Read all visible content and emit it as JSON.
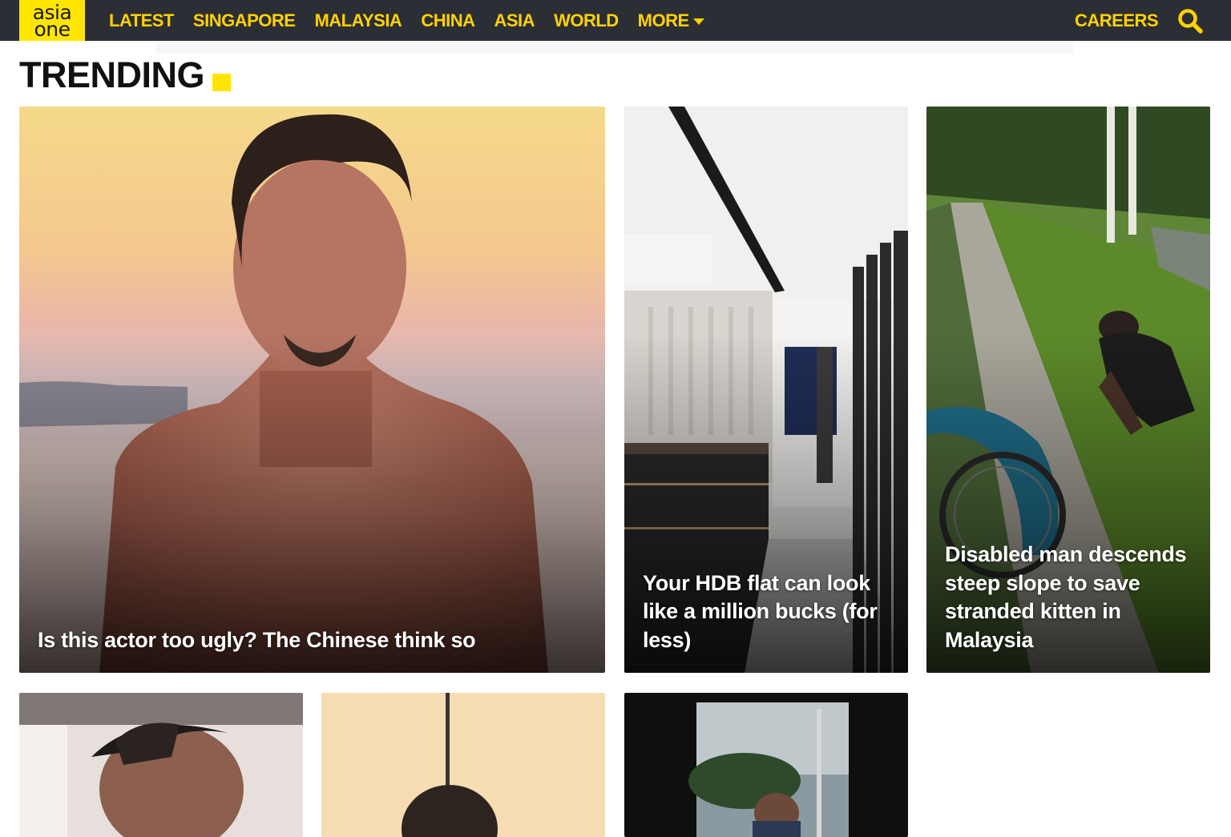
{
  "brand": {
    "logo_line1": "asia",
    "logo_line2": "one",
    "accent_color": "#ffe600",
    "nav_bg": "#2b2e34",
    "nav_text_color": "#ffd200"
  },
  "nav": {
    "items": [
      {
        "label": "LATEST"
      },
      {
        "label": "SINGAPORE"
      },
      {
        "label": "MALAYSIA"
      },
      {
        "label": "CHINA"
      },
      {
        "label": "ASIA"
      },
      {
        "label": "WORLD"
      },
      {
        "label": "MORE"
      }
    ],
    "careers_label": "CAREERS",
    "search_icon": "search-icon",
    "more_icon": "caret-down-icon"
  },
  "section": {
    "title": "TRENDING"
  },
  "articles": [
    {
      "headline": "Is this actor too ugly? The Chinese think so"
    },
    {
      "headline": "Your HDB flat can look like a million bucks (for less)"
    },
    {
      "headline": "Disabled man descends steep slope to save stranded kitten in Malaysia"
    },
    {
      "headline": ""
    },
    {
      "headline": ""
    },
    {
      "headline": ""
    }
  ]
}
